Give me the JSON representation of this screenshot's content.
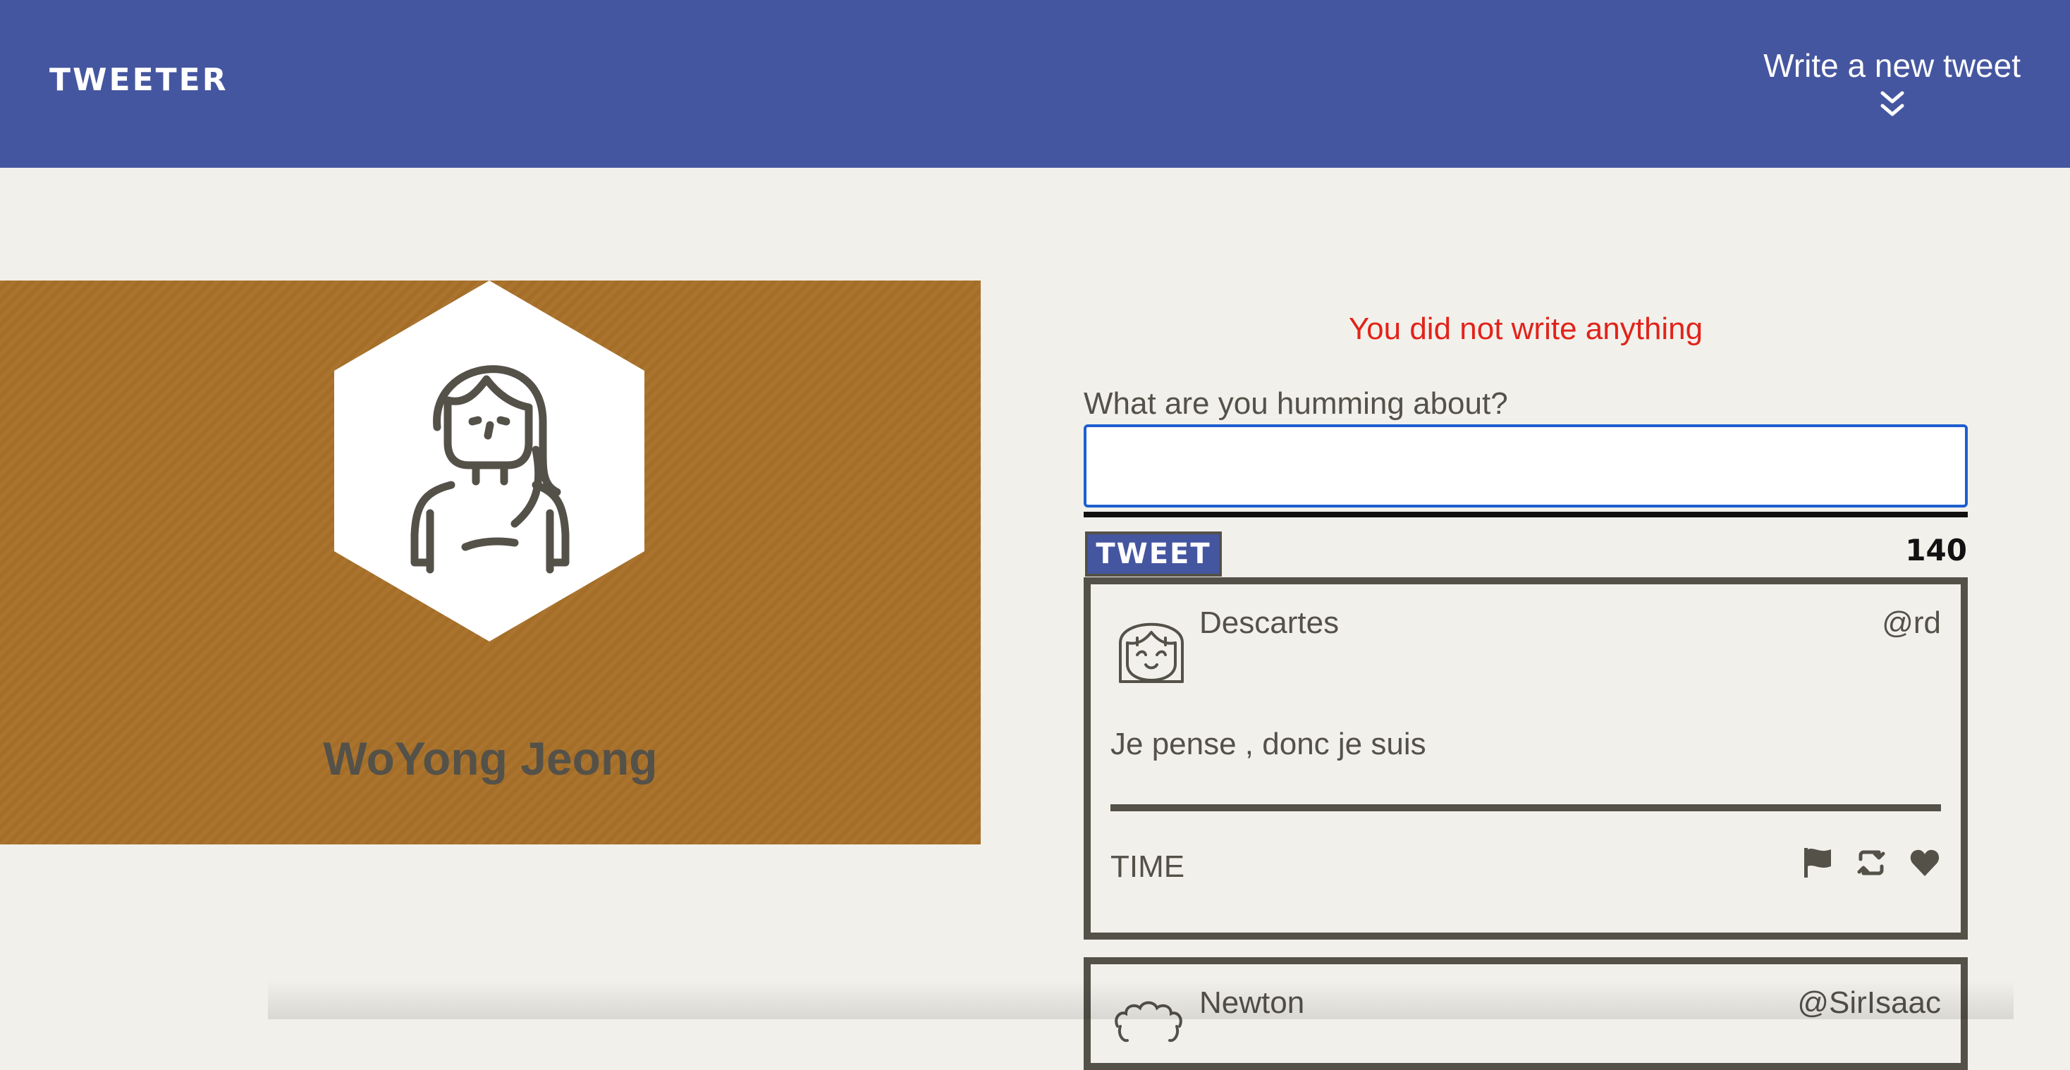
{
  "nav": {
    "brand": "TWEETER",
    "compose_label": "Write a new tweet",
    "compose_icon": "double-chevron-down-icon"
  },
  "profile": {
    "name": "WoYong Jeong",
    "avatar_icon": "woman-avatar-icon",
    "background_color": "#a8712a"
  },
  "composer": {
    "error": "You did not write anything",
    "prompt": "What are you humming about?",
    "text_value": "",
    "button_label": "TWEET",
    "counter": "140"
  },
  "tweets": [
    {
      "name": "Descartes",
      "handle": "@rd",
      "text": "Je pense , donc je suis",
      "time": "TIME",
      "avatar_icon": "smiling-girl-avatar-icon",
      "actions": [
        "flag-icon",
        "retweet-icon",
        "heart-icon"
      ]
    },
    {
      "name": "Newton",
      "handle": "@SirIsaac",
      "avatar_icon": "curly-hair-avatar-icon"
    }
  ],
  "colors": {
    "nav": "#4556a0",
    "background": "#f2f0eb",
    "text": "#545149",
    "error": "#e2231a",
    "focus": "#1d5fcf"
  }
}
